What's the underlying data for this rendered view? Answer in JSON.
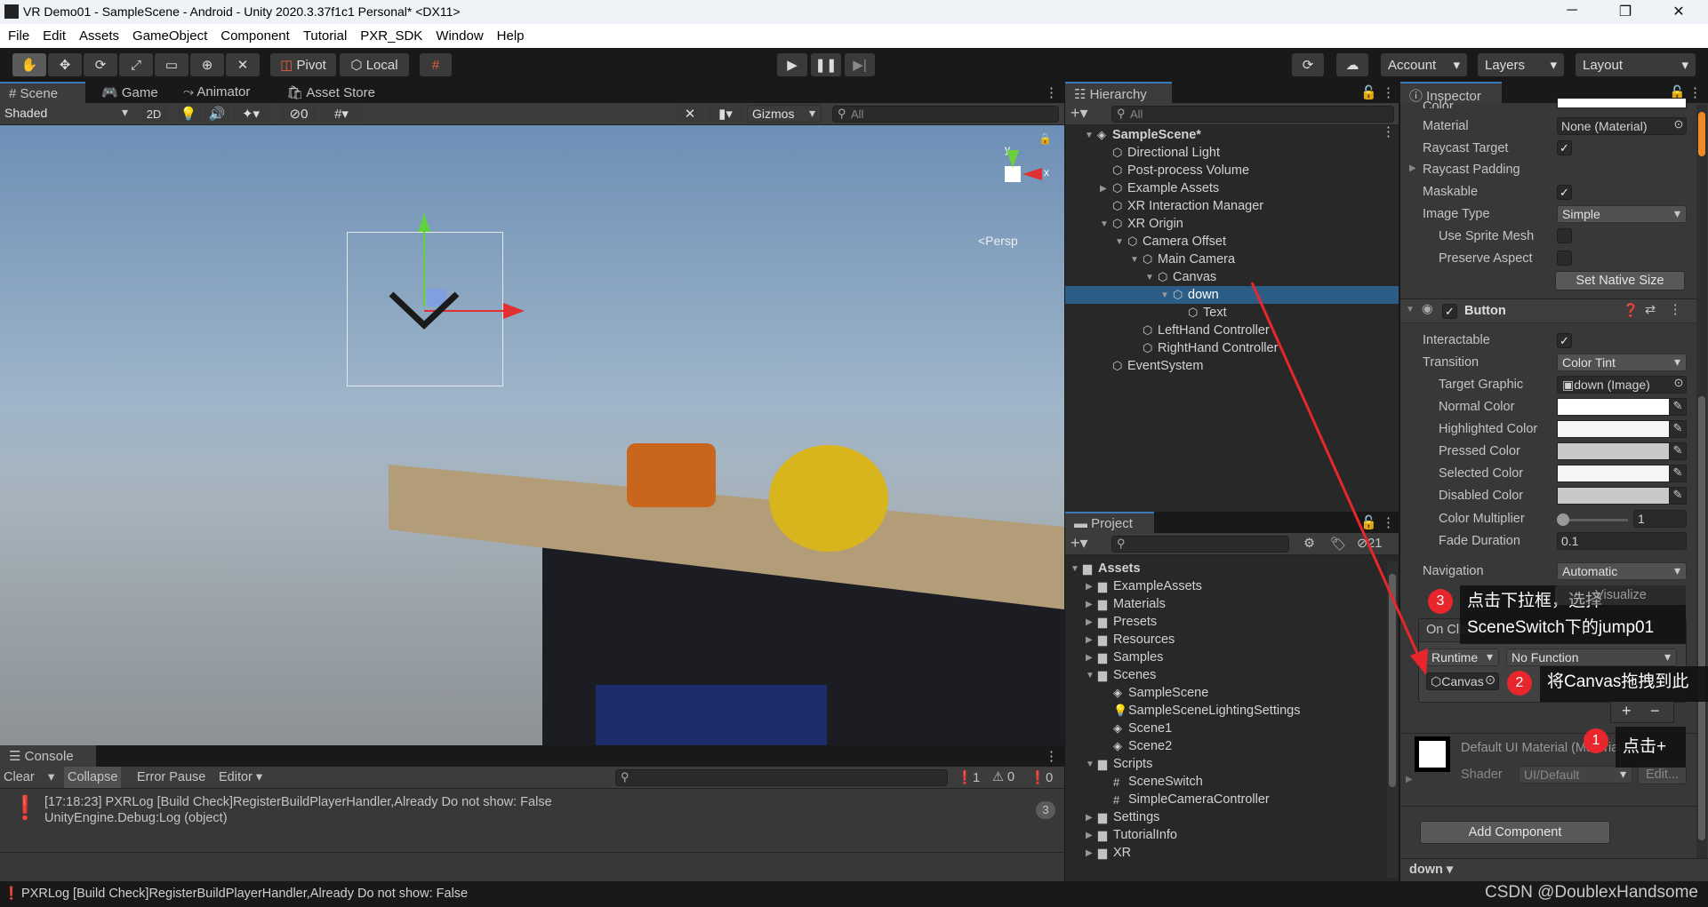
{
  "window": {
    "title": "VR Demo01 - SampleScene - Android - Unity 2020.3.37f1c1 Personal* <DX11>",
    "minimize": "─",
    "maximize": "❐",
    "close": "✕"
  },
  "menu": [
    "File",
    "Edit",
    "Assets",
    "GameObject",
    "Component",
    "Tutorial",
    "PXR_SDK",
    "Window",
    "Help"
  ],
  "toolbar": {
    "pivot": "Pivot",
    "local": "Local",
    "account": "Account",
    "layers": "Layers",
    "layout": "Layout",
    "tools": [
      "hand-tool",
      "move-tool",
      "rotate-tool",
      "scale-tool",
      "rect-tool",
      "transform-tool",
      "custom-tool"
    ]
  },
  "scene": {
    "tabs": [
      "# Scene",
      "Game",
      "Animator",
      "Asset Store"
    ],
    "shading": "Shaded",
    "mode2d": "2D",
    "hidden_count": "0",
    "gizmos": "Gizmos",
    "search_placeholder": "All",
    "persp": "<Persp",
    "axis_y": "y",
    "axis_x": "x"
  },
  "hierarchy": {
    "title": "Hierarchy",
    "search_placeholder": "All",
    "items": [
      {
        "name": "SampleScene*",
        "depth": 0,
        "arrow": "down",
        "icon": "unity",
        "bold": true
      },
      {
        "name": "Directional Light",
        "depth": 1,
        "arrow": "",
        "icon": "cube"
      },
      {
        "name": "Post-process Volume",
        "depth": 1,
        "arrow": "",
        "icon": "cube"
      },
      {
        "name": "Example Assets",
        "depth": 1,
        "arrow": "right",
        "icon": "cube"
      },
      {
        "name": "XR Interaction Manager",
        "depth": 1,
        "arrow": "",
        "icon": "cube"
      },
      {
        "name": "XR Origin",
        "depth": 1,
        "arrow": "down",
        "icon": "cube"
      },
      {
        "name": "Camera Offset",
        "depth": 2,
        "arrow": "down",
        "icon": "cube"
      },
      {
        "name": "Main Camera",
        "depth": 3,
        "arrow": "down",
        "icon": "cube"
      },
      {
        "name": "Canvas",
        "depth": 4,
        "arrow": "down",
        "icon": "cube"
      },
      {
        "name": "down",
        "depth": 5,
        "arrow": "down",
        "icon": "cube",
        "selected": true
      },
      {
        "name": "Text",
        "depth": 6,
        "arrow": "",
        "icon": "cube"
      },
      {
        "name": "LeftHand Controller",
        "depth": 3,
        "arrow": "",
        "icon": "cube"
      },
      {
        "name": "RightHand Controller",
        "depth": 3,
        "arrow": "",
        "icon": "cube"
      },
      {
        "name": "EventSystem",
        "depth": 1,
        "arrow": "",
        "icon": "cube"
      }
    ]
  },
  "project": {
    "title": "Project",
    "count": "21",
    "items": [
      {
        "name": "Assets",
        "depth": 0,
        "arrow": "down",
        "icon": "folder",
        "bold": true
      },
      {
        "name": "ExampleAssets",
        "depth": 1,
        "arrow": "right",
        "icon": "folder"
      },
      {
        "name": "Materials",
        "depth": 1,
        "arrow": "right",
        "icon": "folder"
      },
      {
        "name": "Presets",
        "depth": 1,
        "arrow": "right",
        "icon": "folder"
      },
      {
        "name": "Resources",
        "depth": 1,
        "arrow": "right",
        "icon": "folder"
      },
      {
        "name": "Samples",
        "depth": 1,
        "arrow": "right",
        "icon": "folder"
      },
      {
        "name": "Scenes",
        "depth": 1,
        "arrow": "down",
        "icon": "folder"
      },
      {
        "name": "SampleScene",
        "depth": 2,
        "arrow": "",
        "icon": "unity"
      },
      {
        "name": "SampleSceneLightingSettings",
        "depth": 2,
        "arrow": "",
        "icon": "light"
      },
      {
        "name": "Scene1",
        "depth": 2,
        "arrow": "",
        "icon": "unity"
      },
      {
        "name": "Scene2",
        "depth": 2,
        "arrow": "",
        "icon": "unity"
      },
      {
        "name": "Scripts",
        "depth": 1,
        "arrow": "down",
        "icon": "folder"
      },
      {
        "name": "SceneSwitch",
        "depth": 2,
        "arrow": "",
        "icon": "script"
      },
      {
        "name": "SimpleCameraController",
        "depth": 2,
        "arrow": "",
        "icon": "script"
      },
      {
        "name": "Settings",
        "depth": 1,
        "arrow": "right",
        "icon": "folder"
      },
      {
        "name": "TutorialInfo",
        "depth": 1,
        "arrow": "right",
        "icon": "folder"
      },
      {
        "name": "XR",
        "depth": 1,
        "arrow": "right",
        "icon": "folder"
      }
    ]
  },
  "console": {
    "title": "Console",
    "clear": "Clear",
    "collapse": "Collapse",
    "error_pause": "Error Pause",
    "editor": "Editor",
    "log_count": "1",
    "warn_count": "0",
    "error_count": "0",
    "entry_line1": "[17:18:23] PXRLog [Build Check]RegisterBuildPlayerHandler,Already Do not show: False",
    "entry_line2": "UnityEngine.Debug:Log (object)",
    "entry_repeat": "3"
  },
  "status": {
    "message": "PXRLog [Build Check]RegisterBuildPlayerHandler,Already Do not show: False",
    "watermark": "CSDN @DoublexHandsome"
  },
  "inspector": {
    "title": "Inspector",
    "color_label": "Color",
    "material_label": "Material",
    "material_value": "None (Material)",
    "raycast_target": "Raycast Target",
    "raycast_padding": "Raycast Padding",
    "maskable": "Maskable",
    "image_type_label": "Image Type",
    "image_type_value": "Simple",
    "use_sprite_mesh": "Use Sprite Mesh",
    "preserve_aspect": "Preserve Aspect",
    "set_native_size": "Set Native Size",
    "button_component": "Button",
    "interactable": "Interactable",
    "transition_label": "Transition",
    "transition_value": "Color Tint",
    "target_graphic_label": "Target Graphic",
    "target_graphic_value": "down (Image)",
    "normal_color": "Normal Color",
    "highlighted_color": "Highlighted Color",
    "pressed_color": "Pressed Color",
    "selected_color": "Selected Color",
    "disabled_color": "Disabled Color",
    "colors": {
      "normal": "#FFFFFF",
      "highlighted": "#F5F5F5",
      "pressed": "#C8C8C8",
      "selected": "#F5F5F5",
      "disabled": "#C8C8C8"
    },
    "color_multiplier_label": "Color Multiplier",
    "color_multiplier_value": "1",
    "fade_duration_label": "Fade Duration",
    "fade_duration_value": "0.1",
    "navigation_label": "Navigation",
    "navigation_value": "Automatic",
    "visualize": "Visualize",
    "on_click": "On Click ()",
    "runtime": "Runtime",
    "function": "No Function",
    "object_field": "Canvas",
    "plus": "+",
    "minus": "−",
    "material_name": "Default UI Material (Material)",
    "shader_label": "Shader",
    "shader_value": "UI/Default",
    "edit": "Edit...",
    "add_component": "Add Component",
    "footer_object": "down"
  },
  "annotations": [
    {
      "number": "3",
      "text": "点击下拉框，选择\nSceneSwitch下的jump01"
    },
    {
      "number": "2",
      "text": "将Canvas拖拽到此"
    },
    {
      "number": "1",
      "text": "点击+"
    }
  ],
  "accent": {
    "selection": "#2c5d87",
    "annotation_red": "#e8262b",
    "play_blue": "#3a79bb"
  }
}
